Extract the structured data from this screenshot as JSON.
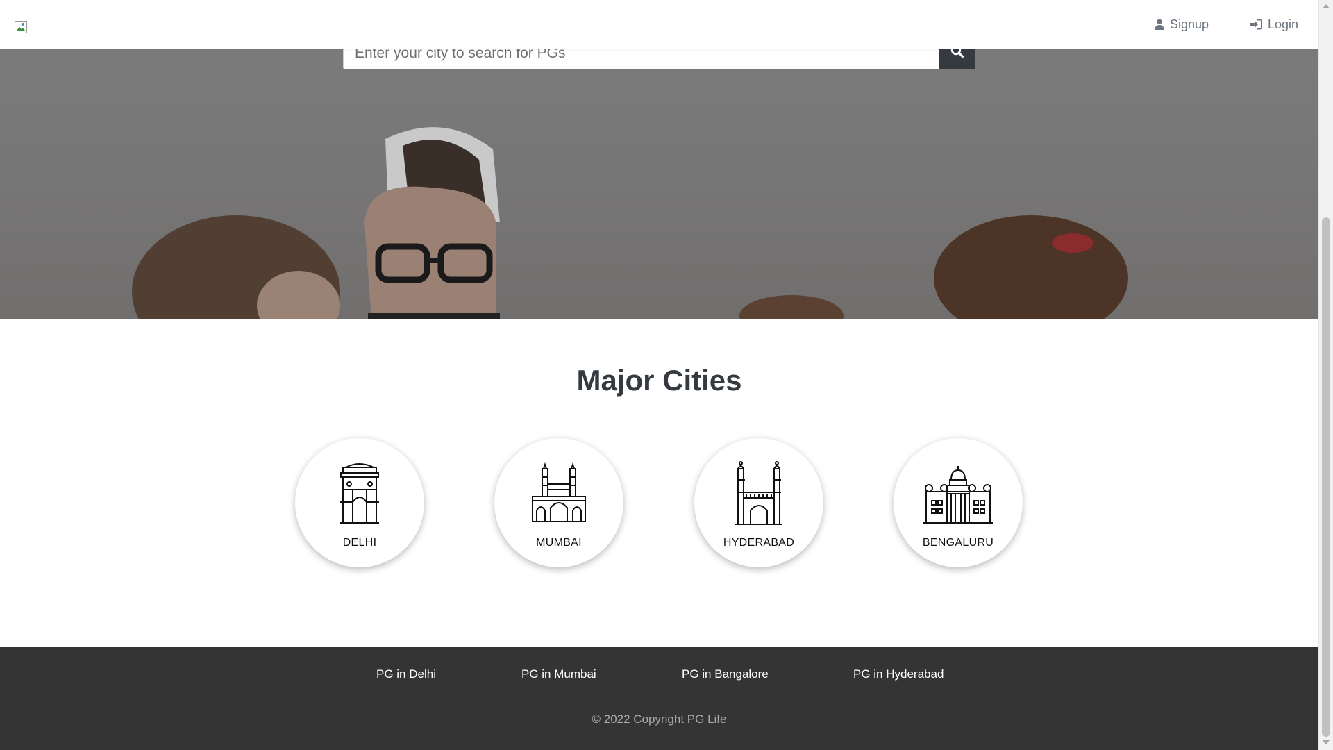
{
  "navbar": {
    "logo_icon": "broken-image-icon",
    "signup_label": "Signup",
    "signup_icon": "user-icon",
    "login_label": "Login",
    "login_icon": "sign-in-icon"
  },
  "hero": {
    "search_placeholder": "Enter your city to search for PGs",
    "search_value": "",
    "search_button_icon": "search-icon"
  },
  "cities_section": {
    "title": "Major Cities",
    "cities": [
      {
        "label": "DELHI",
        "icon": "india-gate-icon"
      },
      {
        "label": "MUMBAI",
        "icon": "gateway-of-india-icon"
      },
      {
        "label": "HYDERABAD",
        "icon": "charminar-icon"
      },
      {
        "label": "BENGALURU",
        "icon": "vidhana-soudha-icon"
      }
    ]
  },
  "footer": {
    "links": [
      {
        "label": "PG in Delhi"
      },
      {
        "label": "PG in Mumbai"
      },
      {
        "label": "PG in Bangalore"
      },
      {
        "label": "PG in Hyderabad"
      }
    ],
    "copyright": "© 2022 Copyright PG Life"
  },
  "colors": {
    "nav_text": "#6c757d",
    "search_button_bg": "#343a40",
    "title_text": "#343a40",
    "footer_bg": "#343434",
    "footer_link": "#ffffff",
    "footer_copyright": "#aaaaaa"
  }
}
